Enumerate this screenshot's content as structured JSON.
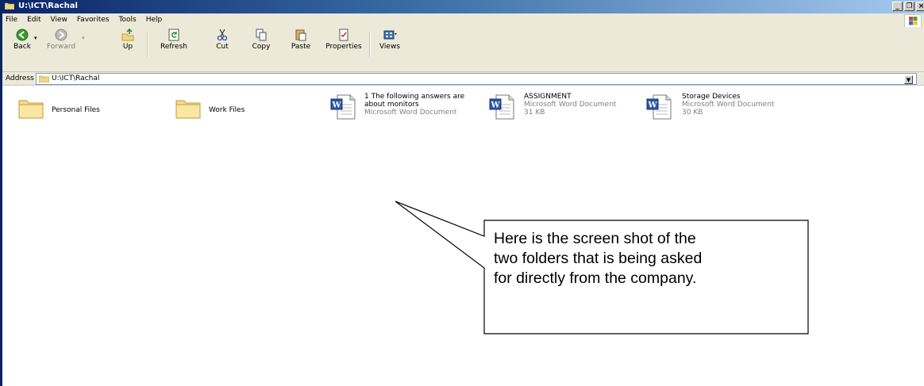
{
  "window": {
    "title": "U:\\ICT\\Rachal"
  },
  "menu": [
    "File",
    "Edit",
    "View",
    "Favorites",
    "Tools",
    "Help"
  ],
  "toolbar": {
    "back": "Back",
    "forward": "Forward",
    "up": "Up",
    "refresh": "Refresh",
    "cut": "Cut",
    "copy": "Copy",
    "paste": "Paste",
    "properties": "Properties",
    "views": "Views"
  },
  "address": {
    "label": "Address",
    "value": "U:\\ICT\\Rachal"
  },
  "folders": [
    {
      "name": "Personal Files"
    },
    {
      "name": "Work Files"
    }
  ],
  "files": [
    {
      "line1": "1 The following answers are",
      "line2": "about monitors",
      "type": "Microsoft Word Document",
      "size": ""
    },
    {
      "line1": "ASSIGNMENT",
      "line2": "",
      "type": "Microsoft Word Document",
      "size": "31 KB"
    },
    {
      "line1": "Storage Devices",
      "line2": "",
      "type": "Microsoft Word Document",
      "size": "30 KB"
    }
  ],
  "callout": {
    "line1": "Here is the screen shot of the",
    "line2": "two folders that is being asked",
    "line3": "for directly from the company."
  },
  "colors": {
    "titlebar": "#0a246a",
    "chrome": "#ece9d8",
    "folder": "#f3d57c"
  }
}
